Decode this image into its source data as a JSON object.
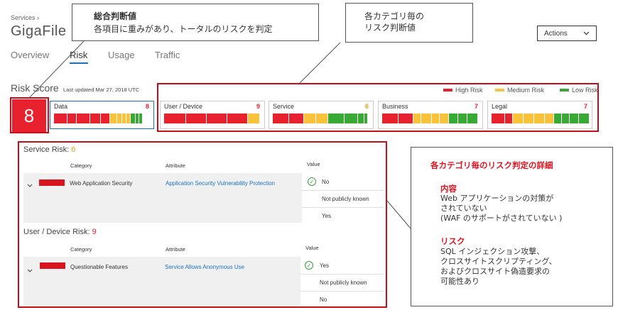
{
  "breadcrumb": "Services  ›",
  "app_title": "GigaFile",
  "tabs": [
    {
      "label": "Overview",
      "active": false
    },
    {
      "label": "Risk",
      "active": true
    },
    {
      "label": "Usage",
      "active": false
    },
    {
      "label": "Traffic",
      "active": false
    }
  ],
  "actions_label": "Actions",
  "risk_score_label": "Risk Score",
  "last_updated": "Last updated Mar 27, 2018 UTC",
  "legend": {
    "high": "High Risk",
    "medium": "Medium Risk",
    "low": "Low Risk"
  },
  "colors": {
    "high": "#e8212e",
    "medium": "#f8c23a",
    "low": "#39a935",
    "selected": "#1a73c2"
  },
  "overall_score": "8",
  "categories": [
    {
      "name": "Data",
      "score": "8",
      "selected": true
    },
    {
      "name": "User / Device",
      "score": "9",
      "selected": false
    },
    {
      "name": "Service",
      "score": "6",
      "selected": false
    },
    {
      "name": "Business",
      "score": "7",
      "selected": false
    },
    {
      "name": "Legal",
      "score": "7",
      "selected": false
    }
  ],
  "service_risk": {
    "title": "Service Risk: ",
    "score": "6",
    "headers": {
      "category": "Category",
      "attribute": "Attribute",
      "value": "Value"
    },
    "category": "Web Application Security",
    "attribute": "Application Security Vulnerability Protection",
    "values": [
      "No",
      "Not publicly known",
      "Yes"
    ]
  },
  "user_risk": {
    "title": "User / Device Risk: ",
    "score": "9",
    "headers": {
      "category": "Category",
      "attribute": "Attribute",
      "value": "Value"
    },
    "category": "Questionable Features",
    "attribute": "Service Allows Anonymous Use",
    "values": [
      "Yes",
      "Not publicly known",
      "No"
    ]
  },
  "callout_overall": {
    "title": "総合判断値",
    "body": "各項目に重みがあり、トータルのリスクを判定"
  },
  "callout_category": {
    "line1": "各カテゴリ毎の",
    "line2": "リスク判断値"
  },
  "callout_detail": {
    "title": "各カテゴリ毎のリスク判定の詳細",
    "content_heading": "内容",
    "content_lines": [
      "Web アプリケーションの対策が",
      "されていない",
      "(WAF のサポートがされていない )"
    ],
    "risk_heading": "リスク",
    "risk_lines": [
      "SQL インジェクション攻撃、",
      "クロスサイトスクリプティング、",
      "およびクロスサイト偽造要求の",
      "可能性あり"
    ]
  }
}
